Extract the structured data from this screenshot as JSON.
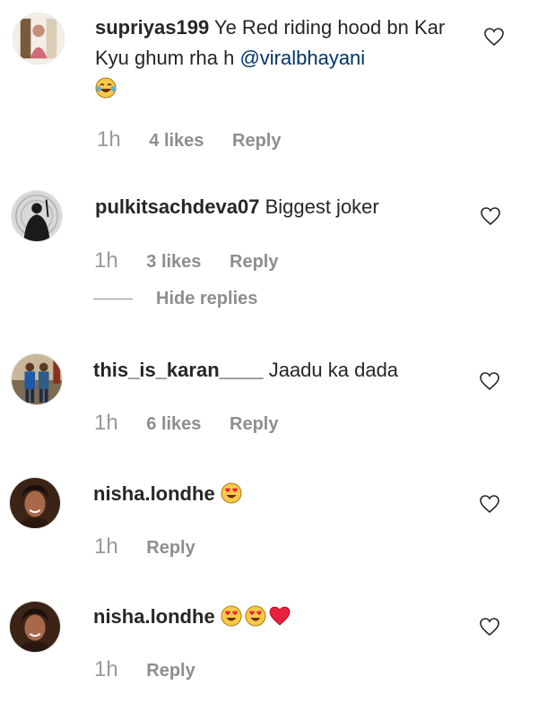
{
  "comments": [
    {
      "username": "supriyas199",
      "text": "Ye Red riding hood bn Kar Kyu ghum rha h",
      "mention": "@viralbhayani",
      "emojis": [
        "laughing-tears-emoji"
      ],
      "time": "1h",
      "likes": "4 likes",
      "reply": "Reply"
    },
    {
      "username": "pulkitsachdeva07",
      "text": "Biggest joker",
      "time": "1h",
      "likes": "3 likes",
      "reply": "Reply"
    },
    {
      "username": "this_is_karan____",
      "text": "Jaadu ka dada",
      "time": "1h",
      "likes": "6 likes",
      "reply": "Reply"
    },
    {
      "username": "nisha.londhe",
      "emojis": [
        "heart-eyes-emoji"
      ],
      "time": "1h",
      "reply": "Reply"
    },
    {
      "username": "nisha.londhe",
      "emojis": [
        "heart-eyes-emoji",
        "heart-eyes-emoji",
        "red-heart-emoji"
      ],
      "time": "1h",
      "reply": "Reply"
    }
  ],
  "hide_replies": "Hide replies",
  "icons": {
    "like": "heart-outline-icon"
  },
  "colors": {
    "text": "#262626",
    "secondary": "#8e8e8e",
    "mention": "#003569",
    "heart_red": "#ed2939"
  }
}
